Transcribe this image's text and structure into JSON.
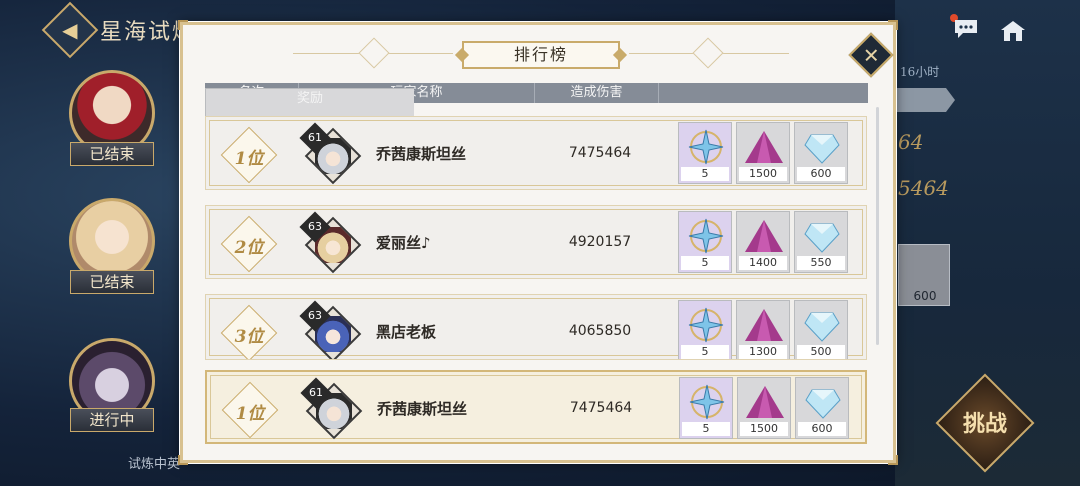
{
  "background": {
    "title": "星海试炼",
    "statuses": [
      "已结束",
      "已结束",
      "进行中"
    ],
    "hours_text": "16小时",
    "num1": "64",
    "num2": "5464",
    "reward_count": "600",
    "challenge_label": "挑战",
    "footer_text": "试炼中英"
  },
  "modal": {
    "title": "排行榜",
    "close_icon": "close-icon",
    "headers": {
      "rank": "名次",
      "name": "玩家名称",
      "damage": "造成伤害",
      "reward": "奖励"
    },
    "rows": [
      {
        "rank": "1位",
        "level": "61",
        "name": "乔茜康斯坦丝",
        "damage": "7475464",
        "rewards": [
          "5",
          "1500",
          "600"
        ],
        "hair": "#cfd3da"
      },
      {
        "rank": "2位",
        "level": "63",
        "name": "爱丽丝♪",
        "damage": "4920157",
        "rewards": [
          "5",
          "1400",
          "550"
        ],
        "hair": "#e6cfa0"
      },
      {
        "rank": "3位",
        "level": "63",
        "name": "黑店老板",
        "damage": "4065850",
        "rewards": [
          "5",
          "1300",
          "500"
        ],
        "hair": "#4a63b8"
      }
    ],
    "my_row": {
      "rank": "1位",
      "level": "61",
      "name": "乔茜康斯坦丝",
      "damage": "7475464",
      "rewards": [
        "5",
        "1500",
        "600"
      ],
      "hair": "#cfd3da"
    }
  },
  "colors": {
    "accent_gold": "#c9ab6a",
    "header_gray": "#858c97",
    "panel": "#f7f5f2"
  }
}
